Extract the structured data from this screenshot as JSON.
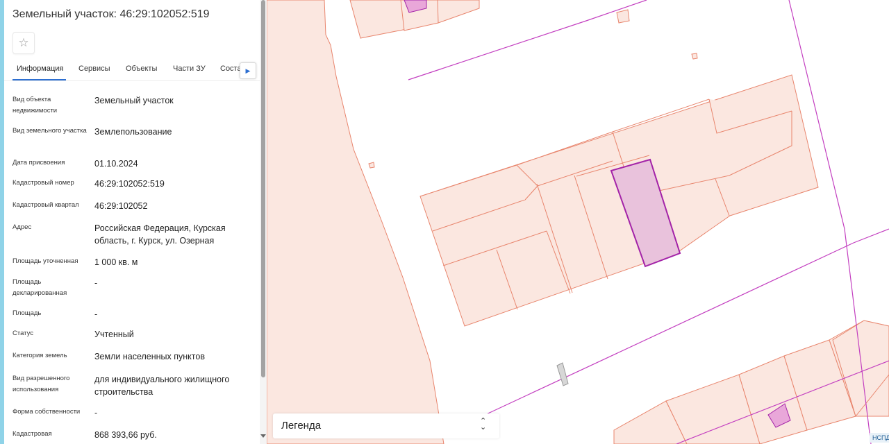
{
  "panel": {
    "title": "Земельный участок: 46:29:102052:519",
    "favorite_icon": "star-outline-icon"
  },
  "tabs": [
    {
      "label": "Информация",
      "active": true
    },
    {
      "label": "Сервисы"
    },
    {
      "label": "Объекты"
    },
    {
      "label": "Части ЗУ"
    },
    {
      "label": "Соста"
    }
  ],
  "tab_next_icon": "chevron-right-icon",
  "properties": [
    {
      "label": "Вид объекта недвижимости",
      "value": "Земельный участок"
    },
    {
      "label": "Вид земельного участка",
      "value": "Землепользование"
    },
    {
      "label": "Дата присвоения",
      "value": "01.10.2024"
    },
    {
      "label": "Кадастровый номер",
      "value": "46:29:102052:519"
    },
    {
      "label": "Кадастровый квартал",
      "value": "46:29:102052"
    },
    {
      "label": "Адрес",
      "value": "Российская Федерация, Курская область, г. Курск, ул. Озерная"
    },
    {
      "label": "Площадь уточненная",
      "value": "1 000 кв. м"
    },
    {
      "label": "Площадь декларированная",
      "value": "-"
    },
    {
      "label": "Площадь",
      "value": "-"
    },
    {
      "label": "Статус",
      "value": "Учтенный"
    },
    {
      "label": "Категория земель",
      "value": "Земли населенных пунктов"
    },
    {
      "label": "Вид разрешенного использования",
      "value": "для индивидуального жилищного строительства"
    },
    {
      "label": "Форма собственности",
      "value": "-"
    },
    {
      "label": "Кадастровая",
      "value": "868 393,66 руб."
    }
  ],
  "legend": {
    "title": "Легенда",
    "toggle_icon": "expand-collapse-icon"
  },
  "map_badge": "НСПД",
  "colors": {
    "parcel_fill": "#fbe7e0",
    "parcel_stroke": "#e8856d",
    "selected_fill": "#e9c2dc",
    "selected_stroke": "#a323a8",
    "boundary_line": "#c33fc0",
    "tab_accent": "#2d6fd1"
  }
}
